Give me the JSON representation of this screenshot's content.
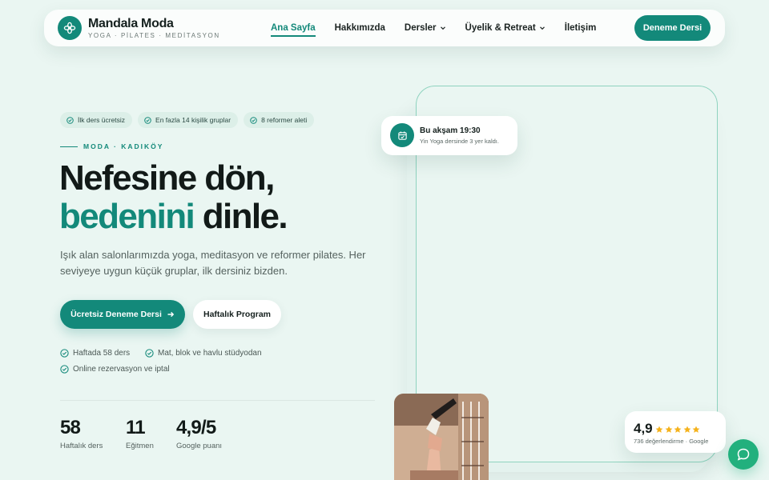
{
  "nav": {
    "brand_name": "Mandala Moda",
    "brand_tagline": "YOGA · PİLATES · MEDİTASYON",
    "items": [
      {
        "label": "Ana Sayfa",
        "active": true,
        "has_dropdown": false
      },
      {
        "label": "Hakkımızda",
        "active": false,
        "has_dropdown": false
      },
      {
        "label": "Dersler",
        "active": false,
        "has_dropdown": true
      },
      {
        "label": "Üyelik & Retreat",
        "active": false,
        "has_dropdown": true
      },
      {
        "label": "İletişim",
        "active": false,
        "has_dropdown": false
      }
    ],
    "cta_label": "Deneme Dersi"
  },
  "hero": {
    "badges": [
      "İlk ders ücretsiz",
      "En fazla 14 kişilik gruplar",
      "8 reformer aleti"
    ],
    "eyebrow": "MODA · KADIKÖY",
    "headline_line1": "Nefesine dön,",
    "headline_accent": "bedenini",
    "headline_rest": " dinle.",
    "lead": "Işık alan salonlarımızda yoga, meditasyon ve reformer pilates. Her seviyeye uygun küçük gruplar, ilk dersiniz bizden.",
    "primary_button": "Ücretsiz Deneme Dersi",
    "secondary_button": "Haftalık Program",
    "features": [
      "Haftada 58 ders",
      "Mat, blok ve havlu stüdyodan",
      "Online rezervasyon ve iptal"
    ],
    "stats": [
      {
        "value": "58",
        "label": "Haftalık ders"
      },
      {
        "value": "11",
        "label": "Eğitmen"
      },
      {
        "value": "4,9/5",
        "label": "Google puanı"
      }
    ]
  },
  "event_card": {
    "title": "Bu akşam 19:30",
    "subtitle": "Yin Yoga dersinde 3 yer kaldı."
  },
  "rating_card": {
    "score": "4,9",
    "stars": 5,
    "subtitle": "736 değerlendirme · Google"
  },
  "colors": {
    "accent": "#13897a",
    "background": "#eaf6f2",
    "star": "#f5b21b",
    "chat": "#22b07d"
  },
  "icons": {
    "logo": "flower-icon",
    "check": "check-circle-icon",
    "calendar": "calendar-check-icon",
    "arrow": "arrow-right-icon",
    "chat": "chat-bubble-icon"
  }
}
